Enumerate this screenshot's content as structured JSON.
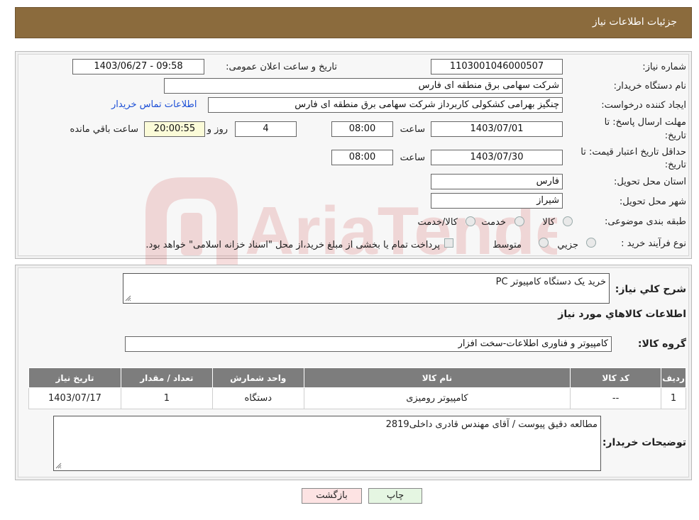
{
  "header": {
    "title": "جزئیات اطلاعات نیاز"
  },
  "form": {
    "need_number_label": "شماره نیاز:",
    "need_number": "1103001046000507",
    "announce_label": "تاریخ و ساعت اعلان عمومی:",
    "announce_value": "1403/06/27 - 09:58",
    "buyer_org_label": "نام دستگاه خریدار:",
    "buyer_org": "شرکت سهامی برق منطقه ای فارس",
    "creator_label": "ایجاد کننده درخواست:",
    "creator": "چنگیز  بهرامی کشکولی کاربرداز شرکت سهامی برق منطقه ای فارس",
    "contact_link": "اطلاعات تماس خریدار",
    "deadline_label_1": "مهلت ارسال پاسخ: تا",
    "deadline_label_2": "تاریخ:",
    "deadline_date": "1403/07/01",
    "time_word": "ساعت",
    "deadline_time": "08:00",
    "days_value": "4",
    "days_word": "روز و",
    "remaining_time": "20:00:55",
    "remaining_word": "ساعت باقي مانده",
    "validity_label_1": "حداقل تاریخ اعتبار قیمت: تا",
    "validity_label_2": "تاریخ:",
    "validity_date": "1403/07/30",
    "validity_time": "08:00",
    "province_label": "استان محل تحویل:",
    "province": "فارس",
    "city_label": "شهر محل تحویل:",
    "city": "شیراز",
    "category_label": "طبقه بندی موضوعی:",
    "category_options": [
      "کالا",
      "خدمت",
      "کالا/خدمت"
    ],
    "process_label": "نوع فرآیند خرید :",
    "process_options": [
      "جزیي",
      "متوسط"
    ],
    "payment_note": "پرداخت تمام یا بخشی از مبلغ خرید،از محل \"اسناد خزانه اسلامی\" خواهد بود."
  },
  "details": {
    "summary_label": "شرح کلي نياز:",
    "summary": "خرید یک دستگاه کامپیوتر PC",
    "goods_info_title": "اطلاعات کالاهاي مورد نياز",
    "goods_group_label": "گروه کالا:",
    "goods_group": "کامپیوتر و فناوری اطلاعات-سخت افزار",
    "table": {
      "headers": [
        "رديف",
        "کد کالا",
        "نام کالا",
        "واحد شمارش",
        "تعداد / مقدار",
        "تاریخ نیاز"
      ],
      "rows": [
        [
          "1",
          "--",
          "کامپیوتر رومیزی",
          "دستگاه",
          "1",
          "1403/07/17"
        ]
      ]
    },
    "buyer_notes_label": "توضیحات خریدار:",
    "buyer_notes": "مطالعه دقیق پیوست / آقای مهندس قادری داخلی2819"
  },
  "buttons": {
    "back": "بازگشت",
    "print": "چاپ"
  },
  "watermark_text": "AriaTender.neT",
  "colors": {
    "header": "#8b6b3d",
    "table_header": "#7d7d7d",
    "link": "#1c4fd6"
  }
}
